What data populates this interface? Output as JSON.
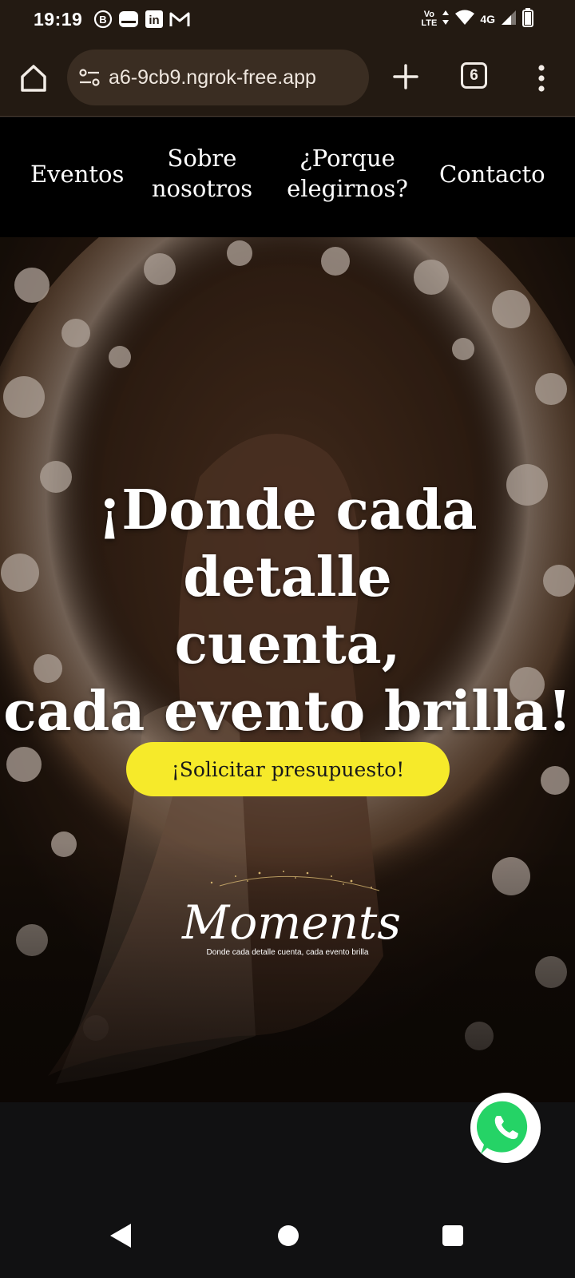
{
  "status_bar": {
    "time": "19:19",
    "notifications": [
      "b-circle-icon",
      "messaging-icon",
      "linkedin-icon",
      "gmail-icon"
    ],
    "linkedin_text": "in",
    "gmail_text": "M",
    "b_text": "B",
    "volte_line1": "Vo",
    "volte_line2": "LTE",
    "network": "4G"
  },
  "browser": {
    "url": "a6-9cb9.ngrok-free.app",
    "tab_count": "6"
  },
  "site_nav": {
    "eventos": "Eventos",
    "sobre_line1": "Sobre",
    "sobre_line2": "nosotros",
    "porque_line1": "¿Porque",
    "porque_line2": "elegirnos?",
    "contacto": "Contacto"
  },
  "hero": {
    "title_line1": "¡Donde cada detalle",
    "title_line2": "cuenta,",
    "title_line3": "cada evento brilla!",
    "cta_label": "¡Solicitar presupuesto!",
    "logo_text": "Moments",
    "logo_tagline": "Donde cada detalle cuenta, cada evento brilla"
  },
  "colors": {
    "browser_bg": "#231a12",
    "cta_bg": "#f6ea2a",
    "whatsapp": "#25d366"
  }
}
